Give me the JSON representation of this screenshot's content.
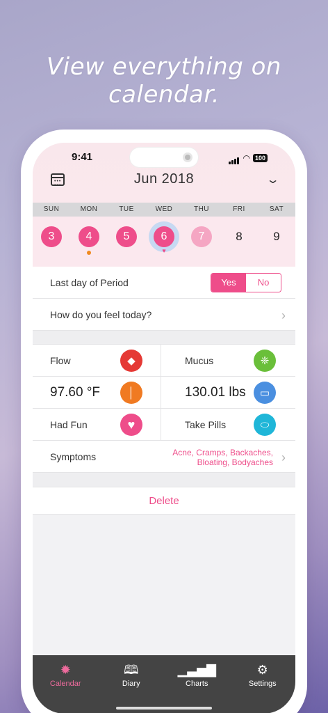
{
  "headline": "View everything on calendar.",
  "status": {
    "time": "9:41",
    "battery": "100"
  },
  "header": {
    "month": "Jun 2018"
  },
  "weekdays": [
    "SUN",
    "MON",
    "TUE",
    "WED",
    "THU",
    "FRI",
    "SAT"
  ],
  "days": [
    {
      "num": "3",
      "style": "pink"
    },
    {
      "num": "4",
      "style": "pink",
      "marker": "dot"
    },
    {
      "num": "5",
      "style": "pink"
    },
    {
      "num": "6",
      "style": "pink",
      "selected": true,
      "marker": "heart"
    },
    {
      "num": "7",
      "style": "light"
    },
    {
      "num": "8",
      "style": "plain"
    },
    {
      "num": "9",
      "style": "plain"
    }
  ],
  "period": {
    "label": "Last day of Period",
    "yes": "Yes",
    "no": "No",
    "selected": "Yes"
  },
  "feel": {
    "label": "How do you feel today?"
  },
  "grid": {
    "flow": "Flow",
    "mucus": "Mucus",
    "temperature": "97.60 °F",
    "weight": "130.01 lbs",
    "had_fun": "Had Fun",
    "take_pills": "Take Pills"
  },
  "symptoms": {
    "label": "Symptoms",
    "line1": "Acne, Cramps, Backaches,",
    "line2": "Bloating, Bodyaches"
  },
  "delete_label": "Delete",
  "tabs": [
    {
      "label": "Calendar",
      "icon": "sun-icon",
      "active": true
    },
    {
      "label": "Diary",
      "icon": "book-icon"
    },
    {
      "label": "Charts",
      "icon": "bar-chart-icon"
    },
    {
      "label": "Settings",
      "icon": "gear-icon"
    }
  ],
  "colors": {
    "accent": "#ee4d8a",
    "flow": "#e53935",
    "mucus": "#6abf3a",
    "temp": "#f07a22",
    "weight": "#4a8fe0",
    "fun": "#ee4d8a",
    "pills": "#1fb6d8",
    "tabbar": "#444444"
  }
}
